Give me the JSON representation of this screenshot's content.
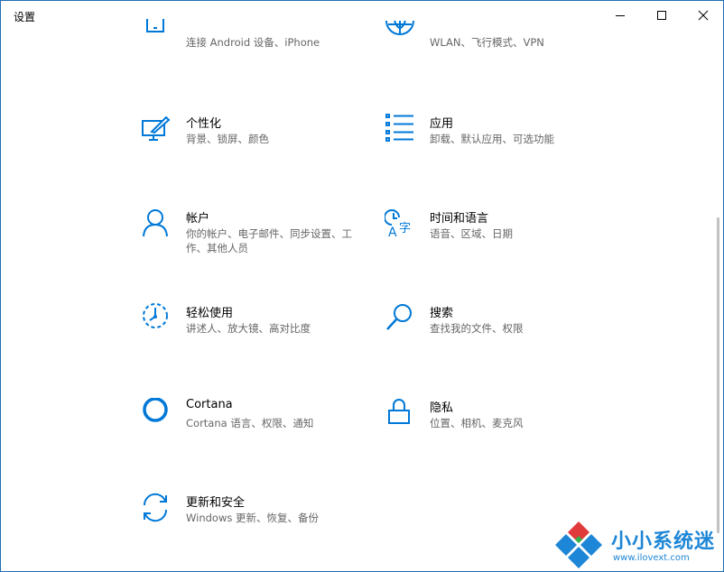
{
  "window": {
    "title": "设置"
  },
  "tiles": [
    {
      "title": "",
      "desc": "连接 Android 设备、iPhone",
      "icon": "phone-icon"
    },
    {
      "title": "",
      "desc": "WLAN、飞行模式、VPN",
      "icon": "globe-icon"
    },
    {
      "title": "个性化",
      "desc": "背景、锁屏、颜色",
      "icon": "personalization-icon"
    },
    {
      "title": "应用",
      "desc": "卸载、默认应用、可选功能",
      "icon": "apps-list-icon"
    },
    {
      "title": "帐户",
      "desc": "你的帐户、电子邮件、同步设置、工作、其他人员",
      "icon": "person-icon"
    },
    {
      "title": "时间和语言",
      "desc": "语音、区域、日期",
      "icon": "time-language-icon"
    },
    {
      "title": "轻松使用",
      "desc": "讲述人、放大镜、高对比度",
      "icon": "ease-of-access-icon"
    },
    {
      "title": "搜索",
      "desc": "查找我的文件、权限",
      "icon": "search-icon"
    },
    {
      "title": "Cortana",
      "desc": "Cortana 语言、权限、通知",
      "icon": "cortana-ring-icon"
    },
    {
      "title": "隐私",
      "desc": "位置、相机、麦克风",
      "icon": "lock-icon"
    },
    {
      "title": "更新和安全",
      "desc": "Windows 更新、恢复、备份",
      "icon": "sync-arrows-icon"
    }
  ],
  "watermark": {
    "name": "小小系统迷",
    "url": "www.ilovext.com"
  },
  "colors": {
    "accent": "#0078d7",
    "watermark": "#1d86d6"
  }
}
